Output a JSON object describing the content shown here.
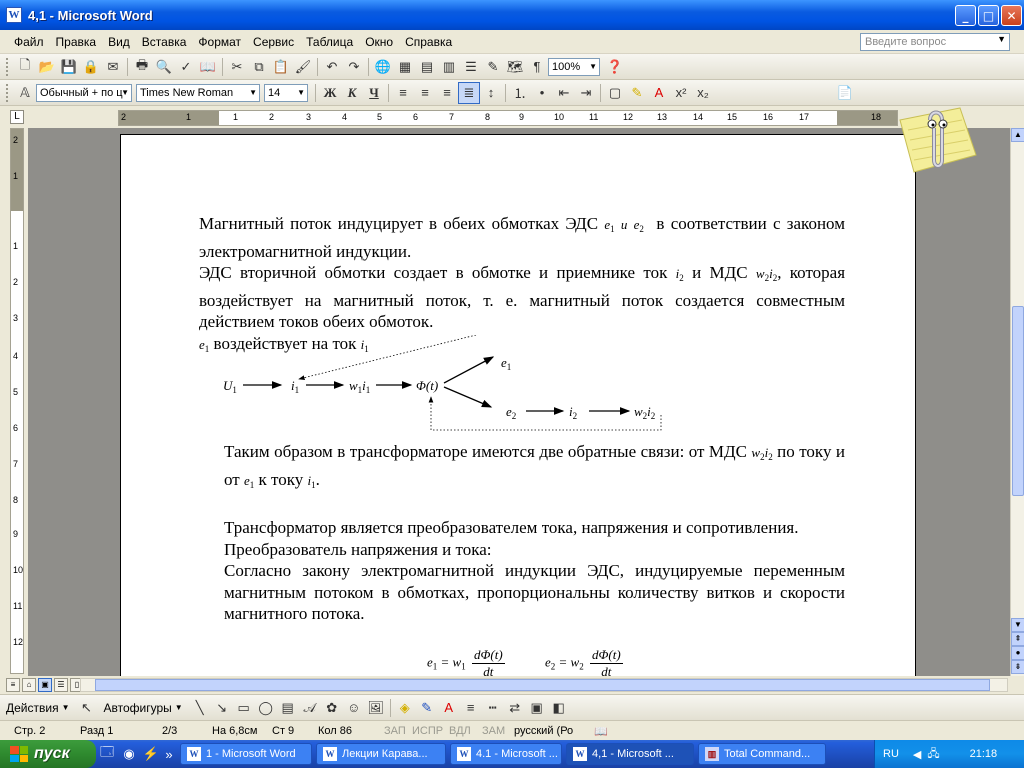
{
  "window": {
    "title": "4,1 - Microsoft Word"
  },
  "menu": [
    "Файл",
    "Правка",
    "Вид",
    "Вставка",
    "Формат",
    "Сервис",
    "Таблица",
    "Окно",
    "Справка"
  ],
  "ask_box": {
    "placeholder": "Введите вопрос"
  },
  "toolbar": {
    "zoom": "100%"
  },
  "format_bar": {
    "style": "Обычный + по ц",
    "font": "Times New Roman",
    "size": "14"
  },
  "ruler": {
    "h_numbers": [
      "2",
      "1",
      "1",
      "2",
      "3",
      "4",
      "5",
      "6",
      "7",
      "8",
      "9",
      "10",
      "11",
      "12",
      "13",
      "14",
      "15",
      "16",
      "17",
      "18"
    ],
    "v_numbers": [
      "2",
      "1",
      "1",
      "2",
      "3",
      "4",
      "5",
      "6",
      "7",
      "8",
      "9",
      "10",
      "11",
      "12"
    ]
  },
  "doc": {
    "p1a": "Магнитный поток индуцирует в обеих обмотках ЭДС",
    "p1b": "в соответствии с законом электромагнитной индукции.",
    "p2a": "ЭДС вторичной обмотки создает в обмотке и приемнике ток",
    "p2b": "и МДС",
    "p2c": ", которая воздействует на магнитный поток, т. е. магнитный поток создается совместным действием токов обеих обмоток.",
    "p3": "воздействует на ток",
    "p4a": "Таким образом в трансформаторе имеются две обратные связи: от МДС",
    "p4b": "по току и от",
    "p4c": "к току",
    "p5": "Трансформатор является преобразователем тока, напряжения и сопротивления.",
    "p6": "Преобразователь напряжения и тока:",
    "p7": "Согласно закону электромагнитной индукции ЭДС, индуцируемые переменным магнитным потоком в обмотках, пропорциональны количеству витков и скорости магнитного потока.",
    "conj": "и",
    "sym_e": "e",
    "sym_i": "i",
    "sym_w": "w",
    "sym_U": "U",
    "sym_phi": "Φ(t)",
    "sub1": "1",
    "sub2": "2",
    "f_lhs1": "e",
    "f_eq1": "= w",
    "f_num": "dΦ(t)",
    "f_den": "dt",
    "f_lhs2": "e",
    "f_eq2": "= w"
  },
  "drawing_bar": {
    "actions": "Действия",
    "autoshapes": "Автофигуры"
  },
  "status": {
    "page": "Стр. 2",
    "section": "Разд 1",
    "pages": "2/3",
    "at": "На 6,8см",
    "line": "Ст 9",
    "col": "Кол 86",
    "rec": "ЗАП",
    "trk": "ИСПР",
    "ext": "ВДЛ",
    "ovr": "ЗАМ",
    "lang": "русский (Ро"
  },
  "taskbar": {
    "start": "пуск",
    "tasks": [
      "1 - Microsoft Word",
      "Лекции Карава...",
      "4.1 - Microsoft ...",
      "4,1 - Microsoft ...",
      "Total Command..."
    ],
    "lang": "RU",
    "clock": "21:18"
  }
}
